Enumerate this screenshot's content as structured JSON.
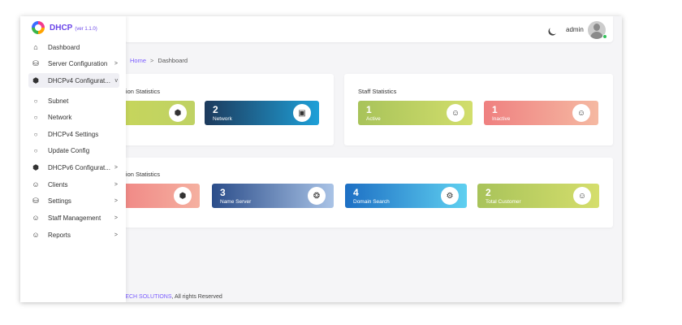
{
  "app": {
    "name": "DHCP",
    "version": "(ver 1.1.0)"
  },
  "topbar": {
    "user_name": "admin"
  },
  "breadcrumb": {
    "home": "Home",
    "separator": ">",
    "current": "Dashboard"
  },
  "sidebar": {
    "items": [
      {
        "label": "Dashboard",
        "icon": "home-icon",
        "chevron": ""
      },
      {
        "label": "Server Configuration",
        "icon": "drive-icon",
        "chevron": ">"
      },
      {
        "label": "DHCPv4 Configurat...",
        "icon": "cube-icon",
        "chevron": "v"
      },
      {
        "label": "Subnet",
        "icon": "circle-icon",
        "chevron": ""
      },
      {
        "label": "Network",
        "icon": "circle-icon",
        "chevron": ""
      },
      {
        "label": "DHCPv4 Settings",
        "icon": "circle-icon",
        "chevron": ""
      },
      {
        "label": "Update Config",
        "icon": "circle-icon",
        "chevron": ""
      },
      {
        "label": "DHCPv6 Configurat...",
        "icon": "cube-icon",
        "chevron": ">"
      },
      {
        "label": "Clients",
        "icon": "user-icon",
        "chevron": ">"
      },
      {
        "label": "Settings",
        "icon": "database-icon",
        "chevron": ">"
      },
      {
        "label": "Staff Management",
        "icon": "user-check-icon",
        "chevron": ">"
      },
      {
        "label": "Reports",
        "icon": "user-check-icon",
        "chevron": ">"
      }
    ]
  },
  "cards": {
    "config_stats": {
      "title": "uration Statistics",
      "stats": [
        {
          "value": "",
          "label": "",
          "icon": "cube-icon",
          "color_from": "#c8d65a",
          "color_to": "#bfd264"
        },
        {
          "value": "2",
          "label": "Network",
          "icon": "cast-icon",
          "color_from": "#1d3a5c",
          "color_to": "#1ea0d8"
        }
      ]
    },
    "staff_stats": {
      "title": "Staff Statistics",
      "stats": [
        {
          "value": "1",
          "label": "Active",
          "icon": "user-check-icon",
          "color_from": "#a8c35a",
          "color_to": "#d2de6c"
        },
        {
          "value": "1",
          "label": "Inactive",
          "icon": "user-check-icon",
          "color_from": "#ef8080",
          "color_to": "#f5b9a2"
        }
      ]
    },
    "config_stats_2": {
      "title": "uration Statistics",
      "stats": [
        {
          "value": "",
          "label": "",
          "icon": "cube-icon",
          "color_from": "#ef8080",
          "color_to": "#f5b0a0"
        },
        {
          "value": "3",
          "label": "Name Server",
          "icon": "atom-icon",
          "color_from": "#2b4d8a",
          "color_to": "#a9c3e6"
        },
        {
          "value": "4",
          "label": "Domain Search",
          "icon": "settings-icon",
          "color_from": "#1d6fc4",
          "color_to": "#5fd0f0"
        },
        {
          "value": "2",
          "label": "Total Customer",
          "icon": "user-check-icon",
          "color_from": "#a8c35a",
          "color_to": "#d5de6c"
        }
      ]
    }
  },
  "footer": {
    "brand": "LATECH SOLUTIONS",
    "rest": ", All rights Reserved"
  }
}
